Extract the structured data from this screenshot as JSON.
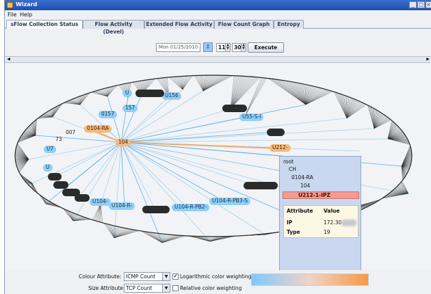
{
  "window": {
    "title": "Wizard",
    "minimize_glyph": "_",
    "maximize_glyph": "□",
    "close_glyph": "×"
  },
  "menu": [
    "File",
    "Help"
  ],
  "tabs": [
    "sFlow Collection Status",
    "Flow Activity (Devel)",
    "Extended Flow Activity",
    "Flow Count Graph",
    "Entropy"
  ],
  "toolbar": {
    "date": "Mon 01/25/2010",
    "calendar_icon": "calendar-icon",
    "calendar_glyph": "↕",
    "hour": "11",
    "minute": "30",
    "execute_label": "Execute"
  },
  "scroll_arrows": {
    "left": "◀",
    "right": "▶"
  },
  "graph": {
    "colors": {
      "edge_dark": "#222222",
      "edge_blue": "#4aa6e6",
      "edge_orange": "#f2a65a",
      "node_blue": "#8fd0f7",
      "node_orange": "#f7b97a"
    },
    "nodes": [
      {
        "label": "U",
        "style": "blue"
      },
      {
        "label": "U156",
        "style": "blue"
      },
      {
        "label": "157",
        "style": "blue"
      },
      {
        "label": "0157",
        "style": "blue"
      },
      {
        "label": "U55-S-I",
        "style": "blue"
      },
      {
        "label": "0104-RA",
        "style": "orange"
      },
      {
        "label": "007",
        "style": "plain"
      },
      {
        "label": "73",
        "style": "plain"
      },
      {
        "label": "U7",
        "style": "blue"
      },
      {
        "label": "104",
        "style": "orange"
      },
      {
        "label": "U212-",
        "style": "orange"
      },
      {
        "label": "U",
        "style": "blue"
      },
      {
        "label": "U104-",
        "style": "blue"
      },
      {
        "label": "U104-R-",
        "style": "blue"
      },
      {
        "label": "U104-R-PB2-",
        "style": "blue"
      },
      {
        "label": "U104-R-PB3-S",
        "style": "blue"
      },
      {
        "label": "",
        "style": "dark"
      },
      {
        "label": "",
        "style": "dark"
      },
      {
        "label": "",
        "style": "dark"
      },
      {
        "label": "",
        "style": "dark"
      },
      {
        "label": "",
        "style": "dark"
      },
      {
        "label": "",
        "style": "dark"
      },
      {
        "label": "",
        "style": "dark"
      },
      {
        "label": "",
        "style": "dark"
      },
      {
        "label": "",
        "style": "dark"
      }
    ]
  },
  "popup": {
    "tree": [
      "root",
      "CH",
      "0104-RA",
      "104"
    ],
    "selected": "U212-1-IPZ",
    "attr_header": [
      "Attribute",
      "Value"
    ],
    "attrs": [
      {
        "name": "IP",
        "value": "172.30"
      },
      {
        "name": "Type",
        "value": "19"
      }
    ]
  },
  "controls": {
    "colour_label": "Colour Attribute:",
    "colour_value": "ICMP Count",
    "log_label": "Logarithmic color weighting",
    "log_checked": true,
    "size_label": "Size Attribute:",
    "size_value": "TCP Count",
    "relative_label": "Relative color weighting",
    "relative_checked": false,
    "gradient": [
      "#7fc8ff",
      "#f0d4c4",
      "#f59a46"
    ]
  }
}
